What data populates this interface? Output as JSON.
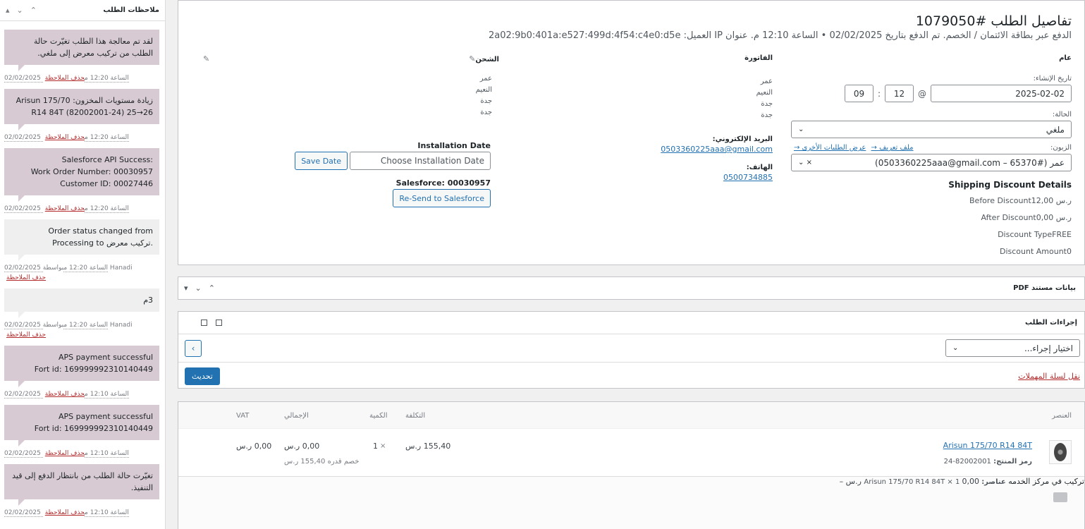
{
  "notes": {
    "title": "ملاحظات الطلب",
    "arrows": [
      "▴",
      "⌄",
      "⌃"
    ],
    "items": [
      {
        "text": "لقد تم معالجة هذا الطلب تغيّرت حالة الطلب من تركيب معرض إلى ملغي.",
        "date": "02/02/2025 الساعة 12:20 م",
        "by": "",
        "delete": "حذف الملاحظة",
        "style": "customer"
      },
      {
        "text": "زيادة مستويات المخزون: Arisun 175/70 R14 84T (82002001-24) 25→26",
        "date": "02/02/2025 الساعة 12:20 م",
        "by": "",
        "delete": "حذف الملاحظة",
        "style": "customer"
      },
      {
        "text": "Salesforce API Success:\nWork Order Number: 00030957\nCustomer ID: 00027446",
        "date": "02/02/2025 الساعة 12:20 م",
        "by": "",
        "delete": "حذف الملاحظة",
        "style": "customer"
      },
      {
        "text": "Order status changed from Processing to تركيب معرض.",
        "date": "02/02/2025 الساعة 12:20 م",
        "by": "بواسطة Hanadi",
        "delete": "حذف الملاحظة",
        "style": "system"
      },
      {
        "text": "3م",
        "date": "02/02/2025 الساعة 12:20 م",
        "by": "بواسطة Hanadi",
        "delete": "حذف الملاحظة",
        "style": "system"
      },
      {
        "text": "APS payment successful\nFort id: 169999992310140449",
        "date": "02/02/2025 الساعة 12:10 م",
        "by": "",
        "delete": "حذف الملاحظة",
        "style": "customer"
      },
      {
        "text": "APS payment successful\nFort id: 169999992310140449",
        "date": "02/02/2025 الساعة 12:10 م",
        "by": "",
        "delete": "حذف الملاحظة",
        "style": "customer"
      },
      {
        "text": "تغيّرت حالة الطلب من بانتظار الدفع إلى قيد التنفيذ.",
        "date": "02/02/2025 الساعة 12:10 م",
        "by": "",
        "delete": "حذف الملاحظة",
        "style": "customer"
      }
    ]
  },
  "order": {
    "title": "تفاصيل الطلب #1079050",
    "subtitle": "الدفع عبر بطاقة الائتمان / الخصم. تم الدفع بتاريخ 02/02/2025 • الساعة 12:10 م. عنوان IP العميل: 2a02:9b0:401a:e527:499d:4f54:c4e0:d5e",
    "general": {
      "heading": "عام",
      "created_label": "تاريخ الإنشاء:",
      "date": "2025-02-02",
      "at": "@",
      "hour": "12",
      "minute": "09",
      "time_sep": ":",
      "status_label": "الحالة:",
      "status": "ملغي",
      "customer_label": "الزبون:",
      "profile_link": "ملف تعريف →",
      "other_orders_link": "عرض الطلبات الأخرى →",
      "customer_value": "عمر (#65370 – 0503360225aaa@gmail.com)",
      "clear": "×"
    },
    "shipping_discount": {
      "title": "Shipping Discount Details",
      "lines": [
        "Before Discount12,00 ر.س",
        "After Discount0,00 ر.س",
        "Discount TypeFREE",
        "Discount Amount0"
      ]
    },
    "billing": {
      "heading": "الفاتورة",
      "address": [
        "عمر",
        "النعيم",
        "جدة",
        "جدة"
      ],
      "email_label": "البريد الإلكتروني:",
      "email": "0503360225aaa@gmail.com",
      "phone_label": "الهاتف:",
      "phone": "0500734885"
    },
    "shipping": {
      "heading": "الشحن",
      "edit_icon": "✎",
      "address": [
        "عمر",
        "النعيم",
        "جدة",
        "جدة"
      ],
      "installation_label": "Installation Date",
      "installation_placeholder": "Choose Installation Date",
      "save_date": "Save Date",
      "salesforce_label": "Salesforce: 00030957",
      "resend": "Re-Send to Salesforce"
    }
  },
  "pdf": {
    "title": "بيانات مستند PDF",
    "arrows": [
      "▾",
      "⌄",
      "⌃"
    ]
  },
  "actions": {
    "title": "إجراءات الطلب",
    "select": "اختيار إجراء...",
    "go": "›",
    "trash": "نقل لسلة المهملات",
    "update": "تحديث"
  },
  "items": {
    "headers": {
      "item": "العنصر",
      "cost": "التكلفة",
      "qty": "الكمية",
      "total": "الإجمالي",
      "vat": "VAT"
    },
    "product": {
      "name": "Arisun 175/70 R14 84T",
      "sku_label": "رمز المنتج:",
      "sku": "82002001-24",
      "cost": "155,40 ر.س",
      "qty_x": "×",
      "qty": "1",
      "total": "0,00 ر.س",
      "discount_note": "خصم قدره 155,40 ر.س",
      "vat": "0,00 ر.س"
    },
    "shipping_line": {
      "name": "تركيب في مركز الخدمه",
      "items_label": "عناصر:",
      "items_value": "Arisun 175/70 R14 84T × 1",
      "total": "0,00 ر.س",
      "vat": "–"
    }
  }
}
